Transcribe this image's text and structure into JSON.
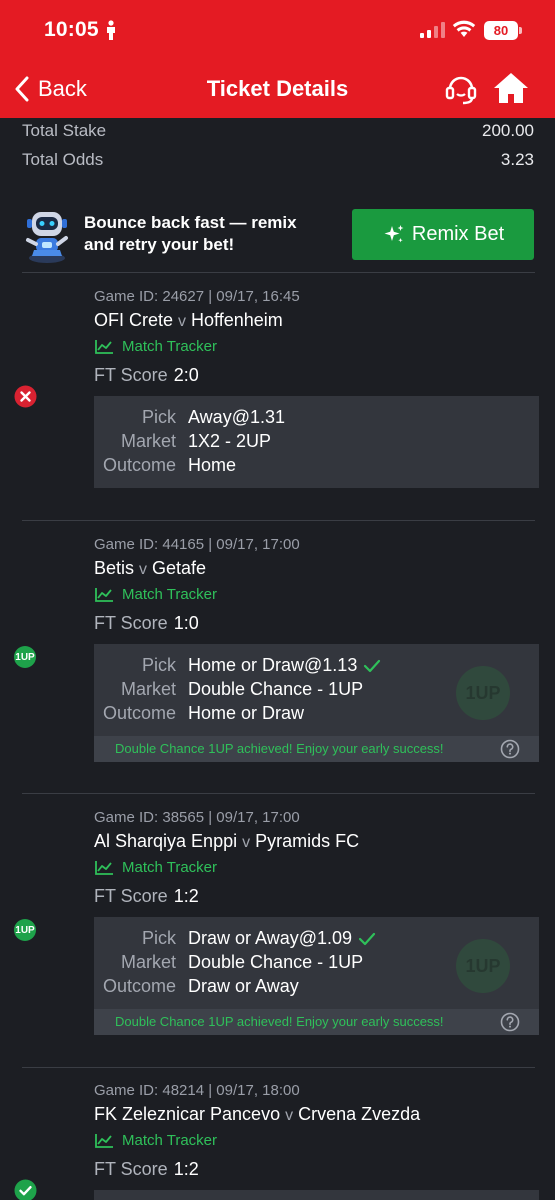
{
  "status_bar": {
    "time": "10:05",
    "battery": "80"
  },
  "nav": {
    "back_label": "Back",
    "title": "Ticket Details"
  },
  "totals": {
    "stake_label": "Total Stake",
    "stake_value": "200.00",
    "odds_label": "Total Odds",
    "odds_value": "3.23"
  },
  "remix": {
    "line1": "Bounce back fast — remix",
    "line2": "and retry your bet!",
    "button_label": "Remix Bet"
  },
  "labels": {
    "match_tracker": "Match Tracker",
    "ft_score": "FT Score",
    "pick": "Pick",
    "market": "Market",
    "outcome": "Outcome",
    "vs": "v"
  },
  "games": [
    {
      "game_id": "Game ID: 24627 | 09/17, 16:45",
      "home": "OFI Crete",
      "away": "Hoffenheim",
      "ft_score": "2:0",
      "pick": "Away@1.31",
      "market": "1X2 - 2UP",
      "outcome": "Home",
      "status": "lost"
    },
    {
      "game_id": "Game ID: 44165 | 09/17, 17:00",
      "home": "Betis",
      "away": "Getafe",
      "ft_score": "1:0",
      "pick": "Home or Draw@1.13",
      "market": "Double Chance - 1UP",
      "outcome": "Home or Draw",
      "status": "1up",
      "footer_msg": "Double Chance 1UP achieved! Enjoy your early success!"
    },
    {
      "game_id": "Game ID: 38565 | 09/17, 17:00",
      "home": "Al Sharqiya Enppi",
      "away": "Pyramids FC",
      "ft_score": "1:2",
      "pick": "Draw or Away@1.09",
      "market": "Double Chance - 1UP",
      "outcome": "Draw or Away",
      "status": "1up",
      "footer_msg": "Double Chance 1UP achieved! Enjoy your early success!"
    },
    {
      "game_id": "Game ID: 48214 | 09/17, 18:00",
      "home": "FK Zeleznicar Pancevo",
      "away": "Crvena Zvezda",
      "ft_score": "1:2",
      "status": "won"
    }
  ],
  "badge_text": "1UP",
  "colors": {
    "header_red": "#e41b23",
    "accent_green": "#1a9a3f",
    "tracker_green": "#2fc05a",
    "lost_red": "#d92231"
  }
}
